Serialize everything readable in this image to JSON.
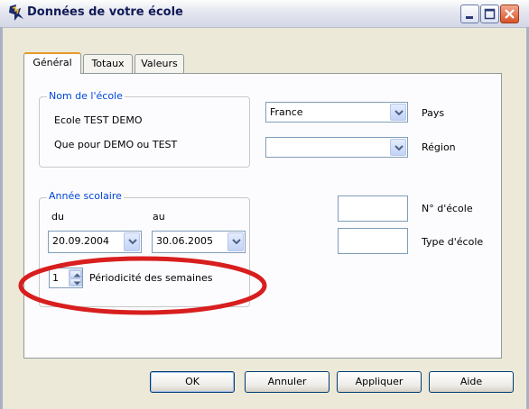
{
  "window": {
    "title": "Données de votre école"
  },
  "tabs": [
    {
      "label": "Général"
    },
    {
      "label": "Totaux"
    },
    {
      "label": "Valeurs"
    }
  ],
  "school_group": {
    "legend": "Nom de l'école",
    "name_line1": "Ecole TEST  DEMO",
    "name_line2": "Que pour DEMO ou TEST"
  },
  "country": {
    "value": "France",
    "label": "Pays"
  },
  "region": {
    "value": "",
    "label": "Région"
  },
  "year_group": {
    "legend": "Année scolaire",
    "from_label": "du",
    "to_label": "au",
    "from_date": "20.09.2004",
    "to_date": "30.06.2005",
    "periodicity_value": "1",
    "periodicity_label": "Périodicité des semaines"
  },
  "school_number": {
    "label": "N° d'école",
    "value": ""
  },
  "school_type": {
    "label": "Type d'école",
    "value": ""
  },
  "buttons": {
    "ok": "OK",
    "cancel": "Annuler",
    "apply": "Appliquer",
    "help": "Aide"
  },
  "colors": {
    "annotation": "#d81e1e",
    "legend": "#0046d5"
  },
  "icons": {
    "app": "app-icon",
    "minimize": "minimize-icon",
    "maximize": "maximize-icon",
    "close": "close-icon"
  }
}
